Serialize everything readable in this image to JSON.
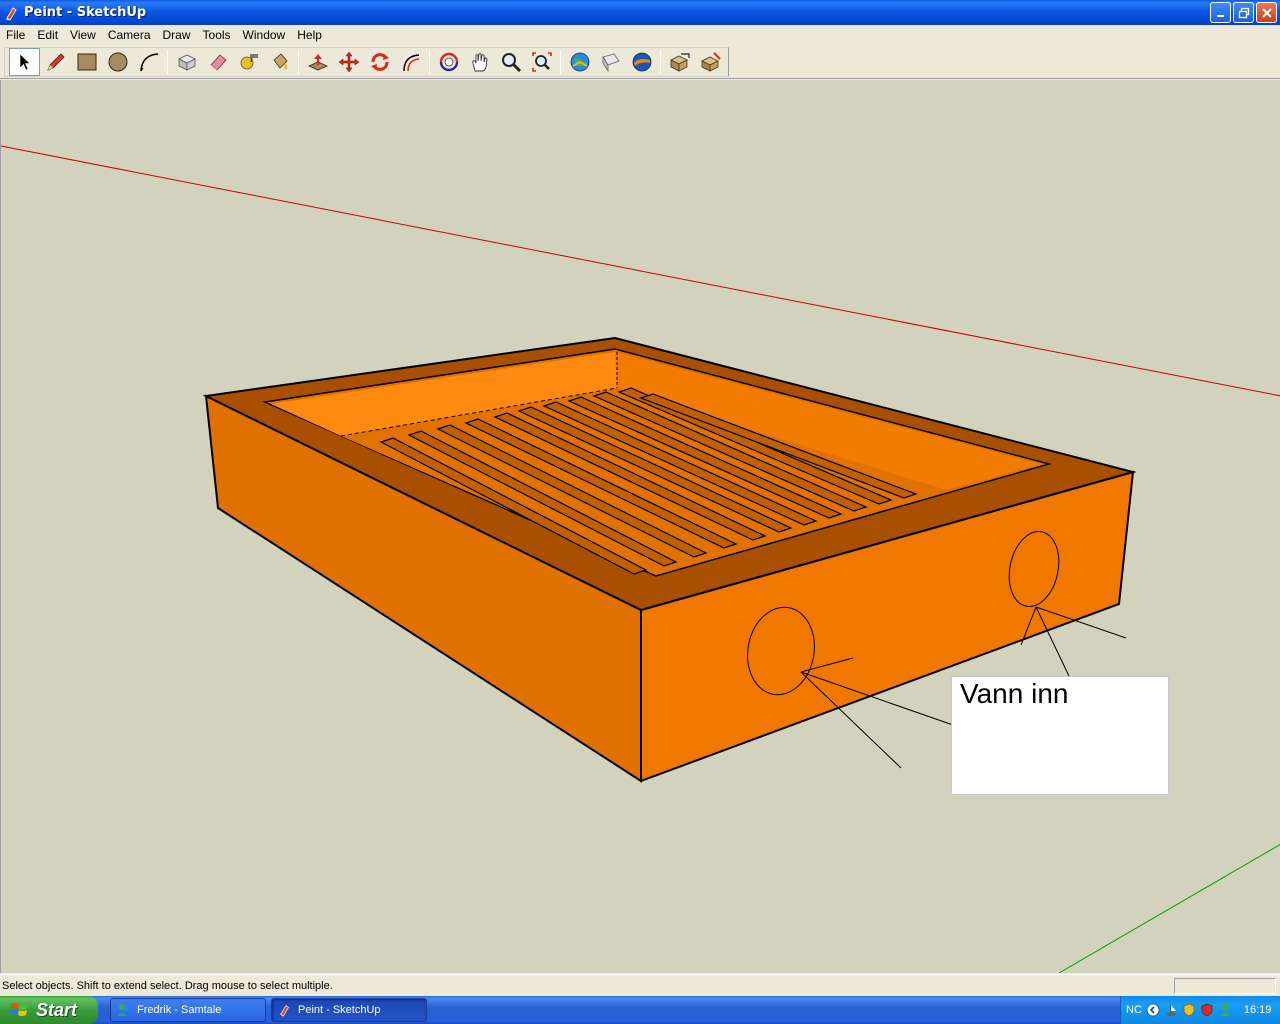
{
  "window": {
    "title": "Peint - SketchUp"
  },
  "menu": {
    "items": [
      "File",
      "Edit",
      "View",
      "Camera",
      "Draw",
      "Tools",
      "Window",
      "Help"
    ]
  },
  "toolbar": {
    "tools": [
      {
        "name": "select-tool-icon",
        "active": true
      },
      {
        "name": "pencil-tool-icon"
      },
      {
        "name": "rectangle-tool-icon"
      },
      {
        "name": "circle-tool-icon"
      },
      {
        "name": "arc-tool-icon"
      },
      {
        "name": "make-component-icon"
      },
      {
        "name": "eraser-tool-icon"
      },
      {
        "name": "tape-measure-icon"
      },
      {
        "name": "paint-bucket-icon"
      },
      {
        "name": "push-pull-icon"
      },
      {
        "name": "move-tool-icon"
      },
      {
        "name": "rotate-tool-icon"
      },
      {
        "name": "offset-tool-icon"
      },
      {
        "name": "orbit-tool-icon"
      },
      {
        "name": "pan-tool-icon"
      },
      {
        "name": "zoom-tool-icon"
      },
      {
        "name": "zoom-extents-icon"
      },
      {
        "name": "get-models-icon"
      },
      {
        "name": "share-model-icon"
      },
      {
        "name": "google-earth-icon"
      },
      {
        "name": "components-icon"
      },
      {
        "name": "materials-icon"
      }
    ]
  },
  "canvas": {
    "callout_text": "Vann inn",
    "model_color": "#f07800",
    "axis_red": "#cc0000",
    "axis_green": "#00a000",
    "background": "#d3d2bd"
  },
  "status": {
    "hint": "Select objects. Shift to extend select. Drag mouse to select multiple."
  },
  "taskbar": {
    "start_label": "Start",
    "buttons": [
      {
        "label": "Fredrik - Samtale"
      },
      {
        "label": "Peint - SketchUp"
      }
    ],
    "tray": {
      "lang": "NC",
      "clock": "16:19"
    }
  }
}
